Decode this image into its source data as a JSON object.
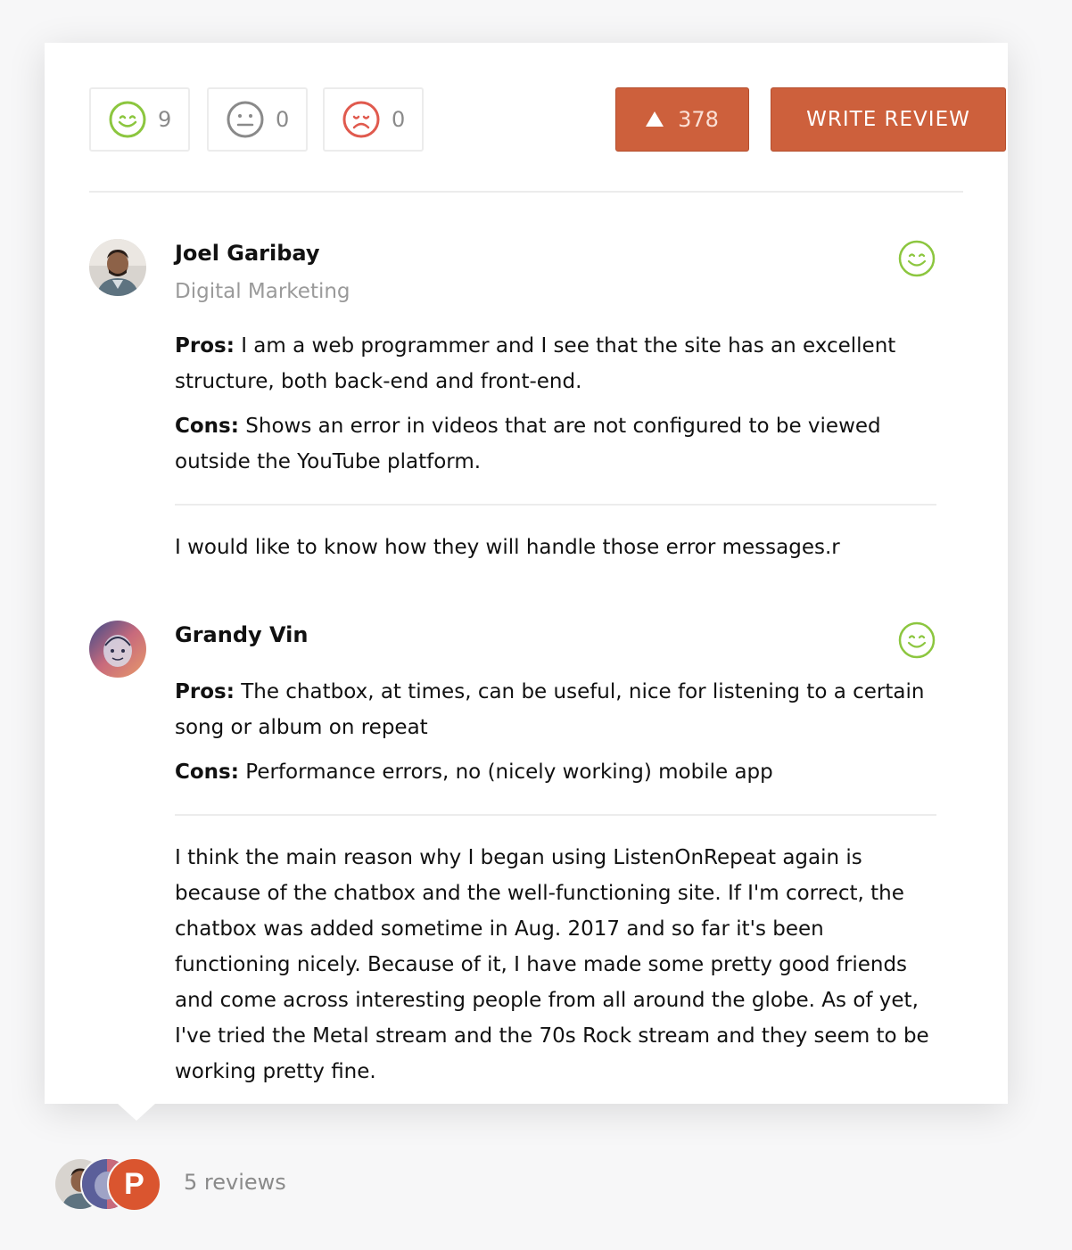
{
  "votes": {
    "positive": {
      "count": "9",
      "icon": "smile-icon",
      "color": "#8cc63f"
    },
    "neutral": {
      "count": "0",
      "icon": "neutral-face-icon",
      "color": "#8a8a8a"
    },
    "negative": {
      "count": "0",
      "icon": "sad-face-icon",
      "color": "#e05a4e"
    }
  },
  "actions": {
    "upvote_count": "378",
    "write_review_label": "WRITE REVIEW",
    "accent_color": "#cd603c"
  },
  "reviews": [
    {
      "name": "Joel Garibay",
      "title": "Digital Marketing",
      "sentiment": "positive",
      "pros_label": "Pros:",
      "pros": " I am a web programmer and I see that the site has an excellent structure, both back-end and front-end.",
      "cons_label": "Cons:",
      "cons": " Shows an error in videos that are not configured to be viewed outside the YouTube platform.",
      "comment": "I would like to know how they will handle those error messages.r"
    },
    {
      "name": "Grandy Vin",
      "title": "",
      "sentiment": "positive",
      "pros_label": "Pros:",
      "pros": " The chatbox, at times, can be useful, nice for listening to a certain song or album on repeat",
      "cons_label": "Cons:",
      "cons": " Performance errors, no (nicely working) mobile app",
      "comment": "I think the main reason why I began using ListenOnRepeat again is because of the chatbox and the well-functioning site. If I'm correct, the chatbox was added sometime in Aug. 2017 and so far it's been functioning nicely. Because of it, I have made some pretty good friends and come across interesting people from all around the globe. As of yet, I've tried the Metal stream and the 70s Rock stream and they seem to be working pretty fine."
    }
  ],
  "footer": {
    "reviews_label": "5 reviews",
    "logo_letter": "P"
  }
}
